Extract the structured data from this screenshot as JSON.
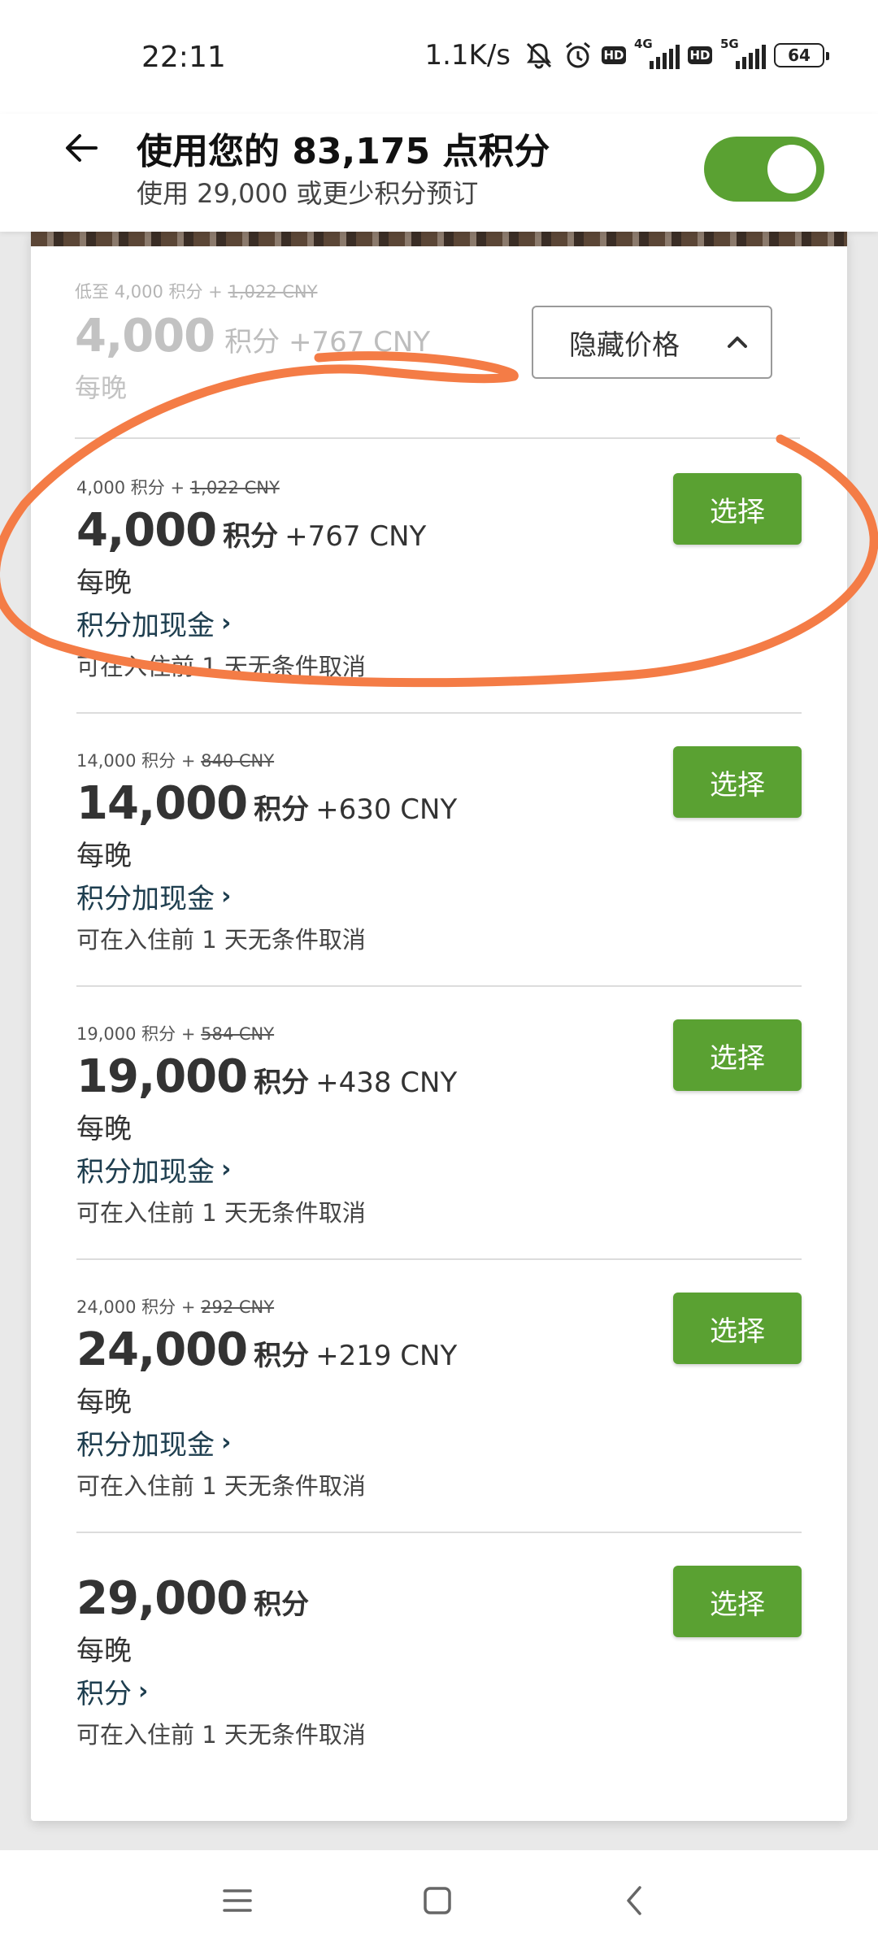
{
  "status_bar": {
    "time": "22:11",
    "net_speed": "1.1K/s",
    "hd1": "HD",
    "sig1_label": "4G",
    "hd2": "HD",
    "sig2_label": "5G",
    "battery": "64"
  },
  "header": {
    "title": "使用您的 83,175 点积分",
    "subtitle": "使用 29,000 或更少积分预订",
    "toggle_on": true
  },
  "summary": {
    "from_label": "低至",
    "small_points": "4,000 积分",
    "small_plus": "+",
    "small_strike": "1,022 CNY",
    "points": "4,000",
    "unit_cash": "积分 +767 CNY",
    "per_night": "每晚",
    "hide_button": "隐藏价格"
  },
  "options": [
    {
      "small_points": "4,000 积分",
      "small_plus": "+",
      "small_strike": "1,022 CNY",
      "points": "4,000",
      "unit": "积分",
      "cash": "+767 CNY",
      "per_night": "每晚",
      "link": "积分加现金",
      "cancel": "可在入住前 1 天无条件取消",
      "button": "选择"
    },
    {
      "small_points": "14,000 积分",
      "small_plus": "+",
      "small_strike": "840 CNY",
      "points": "14,000",
      "unit": "积分",
      "cash": "+630 CNY",
      "per_night": "每晚",
      "link": "积分加现金",
      "cancel": "可在入住前 1 天无条件取消",
      "button": "选择"
    },
    {
      "small_points": "19,000 积分",
      "small_plus": "+",
      "small_strike": "584 CNY",
      "points": "19,000",
      "unit": "积分",
      "cash": "+438 CNY",
      "per_night": "每晚",
      "link": "积分加现金",
      "cancel": "可在入住前 1 天无条件取消",
      "button": "选择"
    },
    {
      "small_points": "24,000 积分",
      "small_plus": "+",
      "small_strike": "292 CNY",
      "points": "24,000",
      "unit": "积分",
      "cash": "+219 CNY",
      "per_night": "每晚",
      "link": "积分加现金",
      "cancel": "可在入住前 1 天无条件取消",
      "button": "选择"
    },
    {
      "points": "29,000",
      "unit": "积分",
      "per_night": "每晚",
      "link": "积分",
      "cancel": "可在入住前 1 天无条件取消",
      "button": "选择"
    }
  ],
  "colors": {
    "accent_green": "#5aa132",
    "link_dark": "#1e3e4f",
    "annotation_orange": "#f47c46"
  },
  "icons": {
    "back": "arrow-left-icon",
    "hide_chevron": "chevron-up-icon",
    "link_chevron": "chevron-right-icon",
    "nav_menu": "menu-icon",
    "nav_home": "home-square-icon",
    "nav_back": "chevron-left-icon"
  }
}
